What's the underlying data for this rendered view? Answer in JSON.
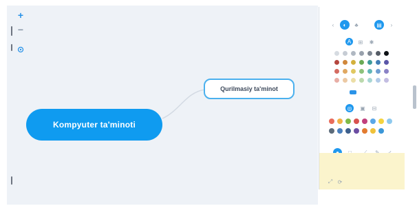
{
  "canvas": {
    "background": "#eef2f7",
    "zoom_in_icon": "plus-icon",
    "zoom_out_icon": "minus-icon",
    "fit_icon": "target-icon"
  },
  "mindmap": {
    "main_topic": "Kompyuter ta'minoti",
    "subtopic": "Qurilmasiy ta'minot",
    "main_color": "#0f9bf0",
    "subtopic_border_color": "#4ab0ee"
  },
  "panel": {
    "background": "#ffffff",
    "note_background": "#fbf4cc",
    "accent": "#1f98ee",
    "size_label": "",
    "footer_label": "",
    "color_rows": [
      [
        "#d6dbe1",
        "#c6ccd4",
        "#b0b8c2",
        "#98a1ac",
        "#7f8893",
        "#555c66",
        "#0e1216"
      ],
      [
        "#b4463f",
        "#d0873b",
        "#d3b03c",
        "#6aaa55",
        "#3f9b9b",
        "#437fb6",
        "#5a56a8"
      ],
      [
        "#d46b62",
        "#e0a862",
        "#e0c861",
        "#8dc27b",
        "#62b6b8",
        "#6e9ed2",
        "#8a82c6"
      ],
      [
        "#e8aea6",
        "#ecc9a4",
        "#ecdea6",
        "#bad9ad",
        "#a8d6d4",
        "#b2cbe8",
        "#c3bde2"
      ]
    ],
    "sticker_colors": [
      "#e86c5b",
      "#f1b247",
      "#7fbb48",
      "#d9534f",
      "#c13f7d",
      "#5aa7e6",
      "#f4d33f",
      "#8ec9ee"
    ],
    "sticker_colors_2": [
      "#5c6b7a",
      "#4a7fbc",
      "#3d5f8c",
      "#6c4ea3",
      "#e27b30",
      "#f0c23a",
      "#3b97d8"
    ]
  }
}
